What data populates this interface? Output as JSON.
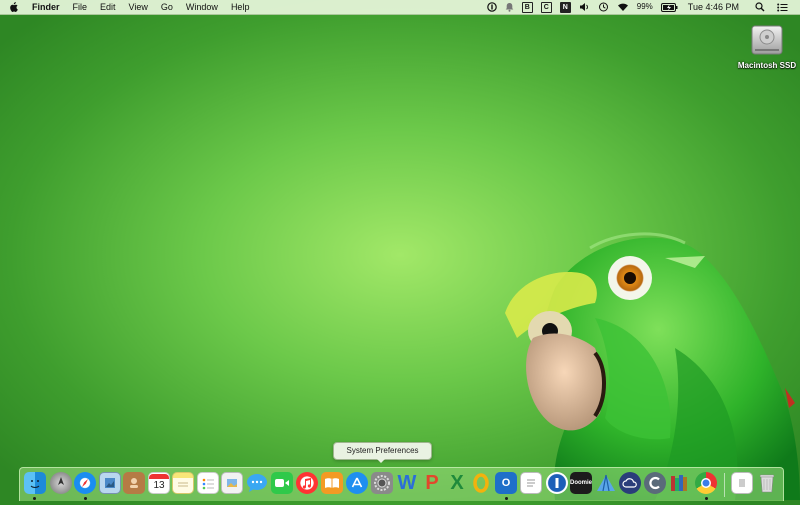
{
  "menubar": {
    "app_name": "Finder",
    "menus": [
      "File",
      "Edit",
      "View",
      "Go",
      "Window",
      "Help"
    ],
    "battery_percent": "99%",
    "clock": "Tue 4:46 PM",
    "status_icons": [
      "1password-icon",
      "notification-bell-icon",
      "b-icon",
      "c-icon",
      "n-icon",
      "volume-icon",
      "time-machine-icon",
      "wifi-icon",
      "battery-charging-icon",
      "spotlight-icon",
      "notification-center-icon"
    ]
  },
  "desktop": {
    "drive_label": "Macintosh SSD"
  },
  "dock": {
    "tooltip": "System Preferences",
    "icons": [
      "finder-icon",
      "launchpad-icon",
      "safari-icon",
      "preview-icon",
      "contacts-icon",
      "calendar-icon",
      "notes-icon",
      "reminders-icon",
      "photos-app-icon",
      "messages-icon",
      "facetime-icon",
      "itunes-icon",
      "ibooks-icon",
      "app-store-icon",
      "system-preferences-icon",
      "word-icon",
      "powerpoint-icon",
      "excel-icon",
      "onenote-icon",
      "outlook-icon",
      "textedit-icon",
      "1password-icon",
      "doomie-icon",
      "xcode-icon",
      "cloud-app-icon",
      "c-app-icon",
      "books-icon",
      "chrome-icon",
      "document-icon",
      "trash-icon"
    ],
    "calendar_day": "13",
    "doomie_text": "Doomie"
  }
}
